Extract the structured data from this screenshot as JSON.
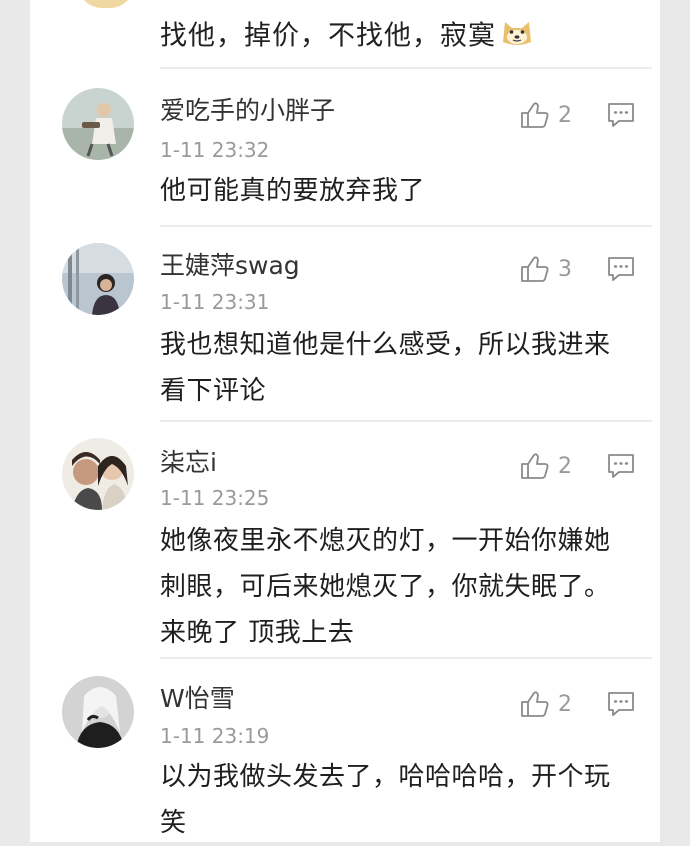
{
  "top_comment": {
    "text": "找他，掉价，不找他，寂寞"
  },
  "comments": [
    {
      "name": "爱吃手的小胖子",
      "time": "1-11 23:32",
      "likes": "2",
      "text": "他可能真的要放弃我了"
    },
    {
      "name": "王婕萍swag",
      "time": "1-11 23:31",
      "likes": "3",
      "text": "我也想知道他是什么感受，所以我进来看下评论"
    },
    {
      "name": "柒忘i",
      "time": "1-11 23:25",
      "likes": "2",
      "text": "她像夜里永不熄灭的灯，一开始你嫌她刺眼，可后来她熄灭了，你就失眠了。 来晚了 顶我上去"
    },
    {
      "name": "W怡雪",
      "time": "1-11 23:19",
      "likes": "2",
      "text": "以为我做头发去了，哈哈哈哈，开个玩笑"
    }
  ],
  "icons": {
    "like": "thumbs-up-icon",
    "reply": "comment-icon",
    "emoji": "doge-emoji-icon"
  }
}
